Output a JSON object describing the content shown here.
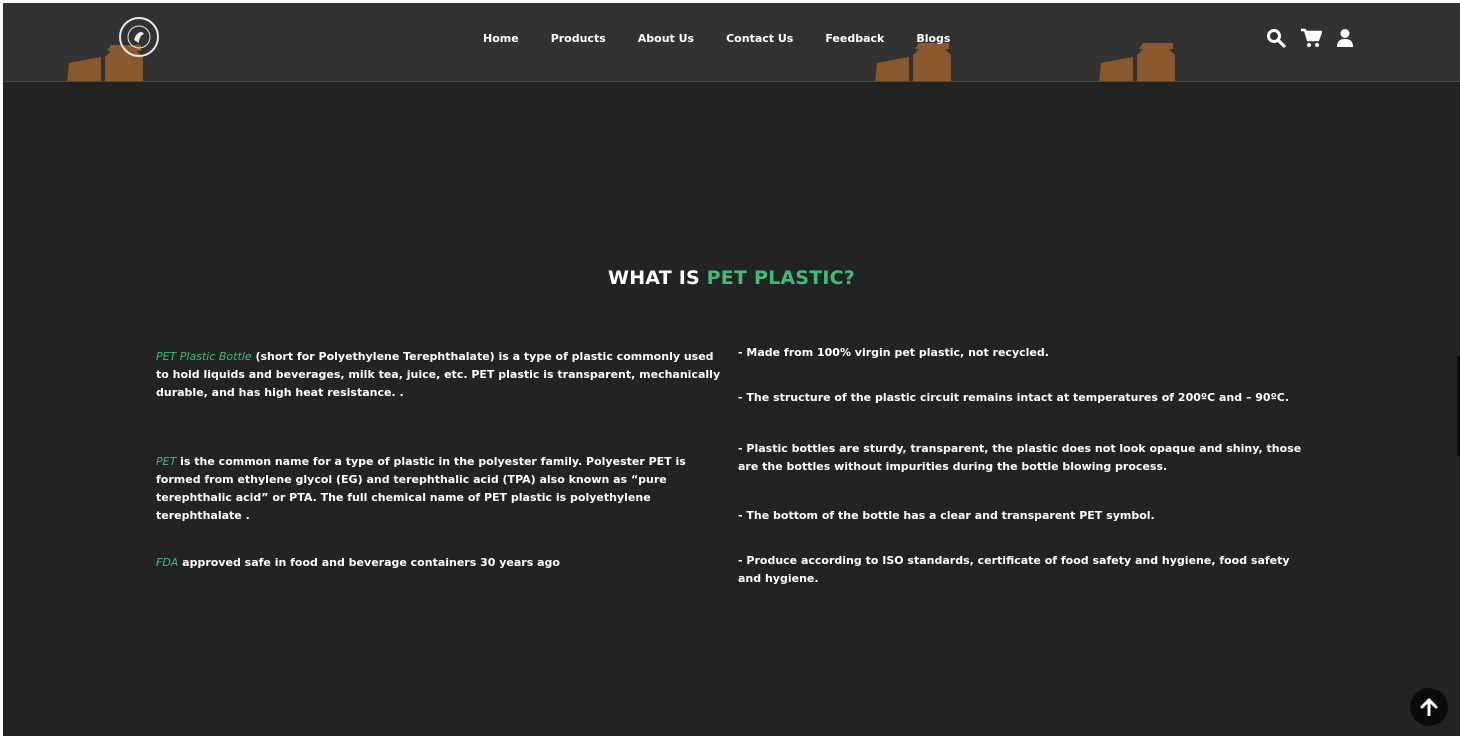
{
  "header": {
    "nav": [
      "Home",
      "Products",
      "About Us",
      "Contact Us",
      "Feedback",
      "Blogs"
    ],
    "icons": [
      "search-icon",
      "cart-icon",
      "user-icon"
    ],
    "jar_color": "#8a5a2e"
  },
  "section": {
    "title_prefix": "WHAT IS ",
    "title_highlight": "PET PLASTIC?",
    "accent_color": "#3dbd76"
  },
  "left": [
    {
      "highlight": "PET Plastic Bottle",
      "text": " (short for Polyethylene Terephthalate) is a type of plastic commonly used to hold liquids and beverages, milk tea, juice, etc. PET plastic is transparent, mechanically durable, and has high heat resistance. ."
    },
    {
      "highlight": "PET",
      "text": " is the common name for a type of plastic in the polyester family. Polyester PET is formed from ethylene glycol (EG) and terephthalic acid (TPA) also known as “pure terephthalic acid” or PTA. The full chemical name of PET plastic is polyethylene terephthalate ."
    },
    {
      "highlight": "FDA",
      "text": " approved safe in food and beverage containers 30 years ago"
    }
  ],
  "right": [
    "- Made from 100% virgin pet plastic, not recycled.",
    "- The structure of the plastic circuit remains intact at temperatures of 200ºC and – 90ºC.",
    "- Plastic bottles are sturdy, transparent, the plastic does not look opaque and shiny, those are the bottles without impurities during the bottle blowing process.",
    "- The bottom of the bottle has a clear and transparent PET symbol.",
    "- Produce according to ISO standards, certificate of food safety and hygiene, food safety and hygiene."
  ]
}
